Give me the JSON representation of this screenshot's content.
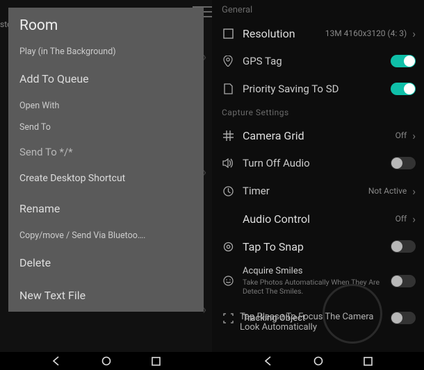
{
  "left": {
    "stub": "sto",
    "menu": {
      "title": "Room",
      "play_bg": "Play (in The Background)",
      "add_queue": "Add To Queue",
      "open_with": "Open With",
      "send_to": "Send To",
      "send_to_all": "Send To */*",
      "desktop_shortcut": "Create Desktop Shortcut",
      "rename": "Rename",
      "copymove": "Copy/move / Send Via Bluetoo….",
      "delete": "Delete",
      "new_text": "New Text File"
    }
  },
  "right": {
    "section_general": "General",
    "resolution": {
      "label": "Resolution",
      "value": "13M 4160x3120 (4: 3)"
    },
    "gps": {
      "label": "GPS Tag",
      "on": true
    },
    "priority_sd": {
      "label": "Priority Saving To SD",
      "on": true
    },
    "section_capture": "Capture Settings",
    "grid": {
      "label": "Camera Grid",
      "value": "Off"
    },
    "audio_off": {
      "label": "Turn Off Audio",
      "on": false
    },
    "timer": {
      "label": "Timer",
      "value": "Not Active"
    },
    "audio_control": {
      "label": "Audio Control",
      "value": "Off"
    },
    "tap_snap": {
      "label": "Tap To Snap",
      "on": false
    },
    "smiles": {
      "label": "Acquire Smiles",
      "sub": "Take Photos Automatically When They Are Detect The Smiles.",
      "on": false
    },
    "tracking": {
      "label": "Tracking Object",
      "on": false
    },
    "focus_overlay": "Tap Please To Focus The Camera Look Automatically"
  }
}
